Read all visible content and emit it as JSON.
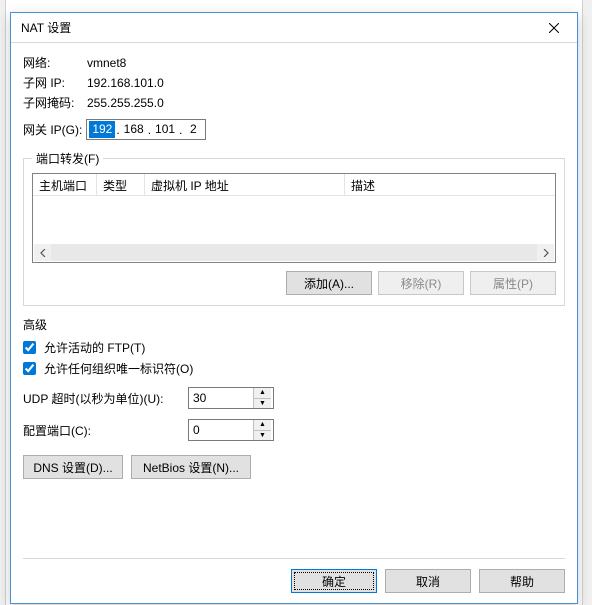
{
  "title": "NAT 设置",
  "info": {
    "network_label": "网络:",
    "network_value": "vmnet8",
    "subnet_ip_label": "子网 IP:",
    "subnet_ip_value": "192.168.101.0",
    "subnet_mask_label": "子网掩码:",
    "subnet_mask_value": "255.255.255.0"
  },
  "gateway": {
    "label": "网关 IP(G):",
    "seg1": "192",
    "seg2": "168",
    "seg3": "101",
    "seg4": "2"
  },
  "port_forward": {
    "legend": "端口转发(F)",
    "columns": {
      "host_port": "主机端口",
      "type": "类型",
      "vm_ip": "虚拟机 IP 地址",
      "desc": "描述"
    },
    "buttons": {
      "add": "添加(A)...",
      "remove": "移除(R)",
      "props": "属性(P)"
    }
  },
  "advanced": {
    "heading": "高级",
    "allow_ftp": "允许活动的 FTP(T)",
    "allow_oui": "允许任何组织唯一标识符(O)",
    "udp_label": "UDP 超时(以秒为单位)(U):",
    "udp_value": "30",
    "cfg_port_label": "配置端口(C):",
    "cfg_port_value": "0",
    "dns_btn": "DNS 设置(D)...",
    "netbios_btn": "NetBios 设置(N)..."
  },
  "footer": {
    "ok": "确定",
    "cancel": "取消",
    "help": "帮助"
  }
}
